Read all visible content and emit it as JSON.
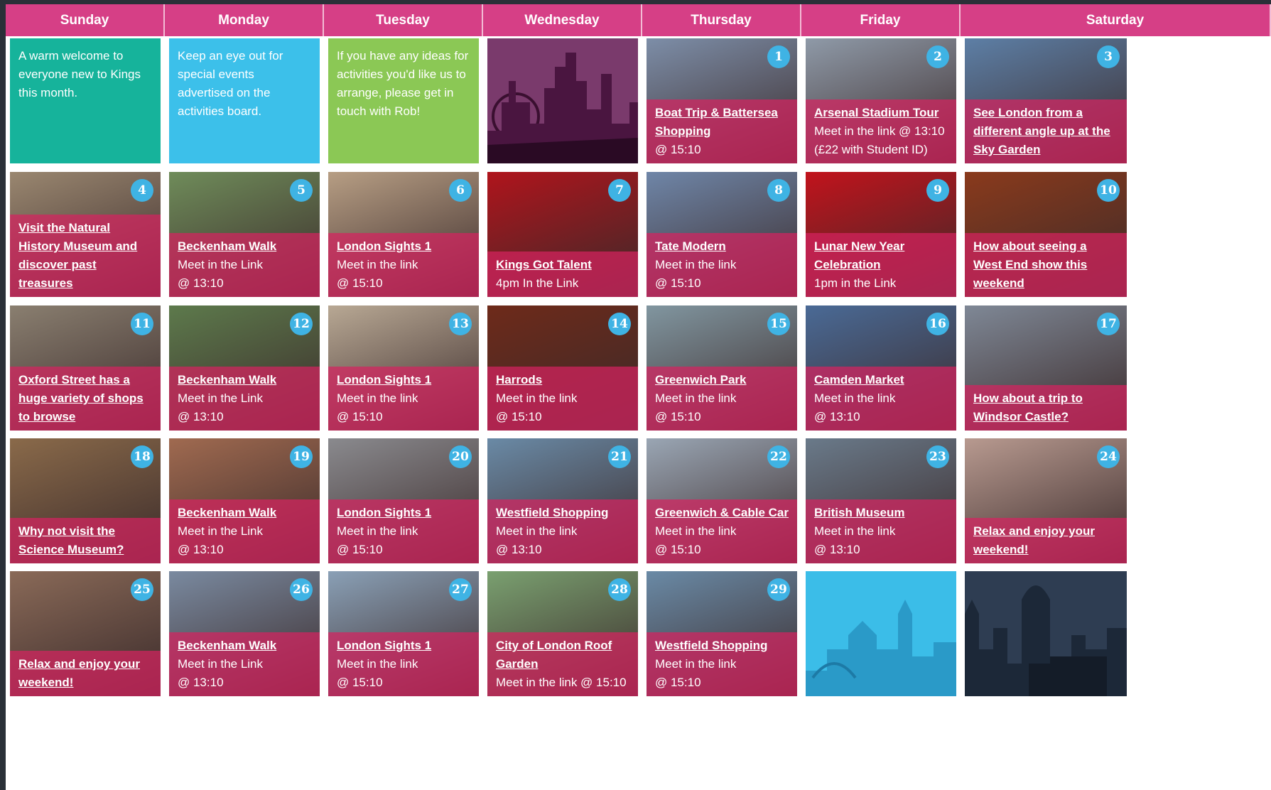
{
  "days": [
    "Sunday",
    "Monday",
    "Tuesday",
    "Wednesday",
    "Thursday",
    "Friday",
    "Saturday"
  ],
  "notes": [
    {
      "text": "A warm welcome to everyone new to Kings this month.",
      "color": "#16b39b"
    },
    {
      "text": "Keep an eye out for special events advertised on the activities board.",
      "color": "#3cc0ea"
    },
    {
      "text": "If you have any ideas for activities you'd like us to arrange, please get in touch with Rob!",
      "color": "#8bc855"
    }
  ],
  "events": [
    {
      "day": "1",
      "title": "Boat Trip & Battersea Shopping",
      "lines": [
        "@ 15:10"
      ],
      "bg": "#7d8ea8"
    },
    {
      "day": "2",
      "title": "Arsenal Stadium Tour",
      "lines": [
        "Meet in the link @ 13:10",
        "(£22 with Student ID)"
      ],
      "bg": "#8f9aa8"
    },
    {
      "day": "3",
      "title": "See London from a different angle up at the Sky Garden",
      "lines": [],
      "bg": "#5d7fa6"
    },
    {
      "day": "4",
      "title": "Visit the Natural History Museum and discover past treasures",
      "lines": [],
      "bg": "#9a8770"
    },
    {
      "day": "5",
      "title": "Beckenham Walk",
      "lines": [
        "Meet in the Link",
        "@ 13:10"
      ],
      "bg": "#6f8c5a"
    },
    {
      "day": "6",
      "title": "London Sights 1",
      "lines": [
        "Meet in the link",
        "@ 15:10"
      ],
      "bg": "#b79e84"
    },
    {
      "day": "7",
      "title": "Kings Got Talent",
      "lines": [
        "4pm In the Link"
      ],
      "bg": "#b0141c"
    },
    {
      "day": "8",
      "title": "Tate Modern",
      "lines": [
        "Meet in the link",
        "@ 15:10"
      ],
      "bg": "#6f86a8"
    },
    {
      "day": "9",
      "title": "Lunar New Year Celebration",
      "lines": [
        "1pm in the Link"
      ],
      "bg": "#c2131c"
    },
    {
      "day": "10",
      "title": "How about seeing a West End show this weekend",
      "lines": [],
      "bg": "#8a3a1c"
    },
    {
      "day": "11",
      "title": "Oxford Street has a huge variety of shops to browse",
      "lines": [],
      "bg": "#8a7f70"
    },
    {
      "day": "12",
      "title": "Beckenham Walk",
      "lines": [
        "Meet in the Link",
        "@ 13:10"
      ],
      "bg": "#5d7a4c"
    },
    {
      "day": "13",
      "title": "London Sights 1",
      "lines": [
        "Meet in the link",
        "@ 15:10"
      ],
      "bg": "#b8a894"
    },
    {
      "day": "14",
      "title": "Harrods",
      "lines": [
        "Meet in the link",
        "@ 15:10"
      ],
      "bg": "#6e2a1a"
    },
    {
      "day": "15",
      "title": "Greenwich Park",
      "lines": [
        "Meet in the link",
        "@ 15:10"
      ],
      "bg": "#8196a0"
    },
    {
      "day": "16",
      "title": "Camden Market",
      "lines": [
        "Meet in the link",
        "@ 13:10"
      ],
      "bg": "#4a6a96"
    },
    {
      "day": "17",
      "title": "How about a trip to Windsor Castle?",
      "lines": [],
      "bg": "#7f8896"
    },
    {
      "day": "18",
      "title": "Why not visit the Science Museum?",
      "lines": [],
      "bg": "#8a6a4a"
    },
    {
      "day": "19",
      "title": "Beckenham Walk",
      "lines": [
        "Meet in the Link",
        "@ 13:10"
      ],
      "bg": "#a06a50"
    },
    {
      "day": "20",
      "title": "London Sights 1",
      "lines": [
        "Meet in the link",
        "@ 15:10"
      ],
      "bg": "#8a8a8e"
    },
    {
      "day": "21",
      "title": "Westfield Shopping",
      "lines": [
        "Meet in the link",
        "@ 13:10"
      ],
      "bg": "#6a8aa6"
    },
    {
      "day": "22",
      "title": "Greenwich & Cable Car",
      "lines": [
        "Meet in the link",
        "@ 15:10"
      ],
      "bg": "#9aa6b4"
    },
    {
      "day": "23",
      "title": "British Museum",
      "lines": [
        "Meet in the link",
        "@ 13:10"
      ],
      "bg": "#6a7a8a"
    },
    {
      "day": "24",
      "title": "Relax and enjoy your weekend!",
      "lines": [],
      "bg": "#b89a90"
    },
    {
      "day": "25",
      "title": "Relax and enjoy your weekend!",
      "lines": [],
      "bg": "#8a6a58"
    },
    {
      "day": "26",
      "title": "Beckenham Walk",
      "lines": [
        "Meet in the Link",
        "@ 13:10"
      ],
      "bg": "#7a8aa0"
    },
    {
      "day": "27",
      "title": "London Sights 1",
      "lines": [
        "Meet in the link",
        "@ 15:10"
      ],
      "bg": "#8aa0b6"
    },
    {
      "day": "28",
      "title": "City of London Roof Garden",
      "lines": [
        "Meet in the link @ 15:10"
      ],
      "bg": "#7aa070"
    },
    {
      "day": "29",
      "title": "Westfield Shopping",
      "lines": [
        "Meet in the link",
        "@ 15:10"
      ],
      "bg": "#6a8aa6"
    }
  ],
  "colors": {
    "header": "#d63f86",
    "overlay": "#d62260",
    "badge": "#3fb3e4",
    "wednesday_tile": "#6b2c5e",
    "friday_end_tile": "#3bbde8",
    "saturday_end_tile": "#2e3d52"
  }
}
